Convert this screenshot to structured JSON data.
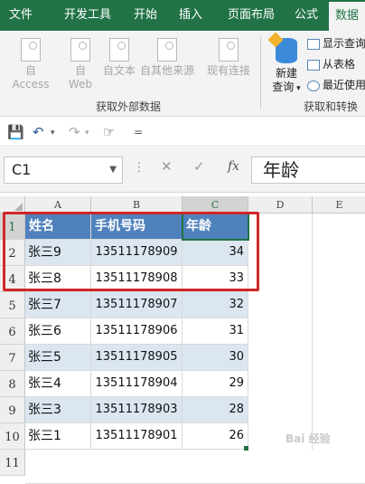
{
  "ribbon": {
    "tabs": [
      {
        "label": "文件",
        "active": false
      },
      {
        "label": "开发工具",
        "active": false
      },
      {
        "label": "开始",
        "active": false
      },
      {
        "label": "插入",
        "active": false
      },
      {
        "label": "页面布局",
        "active": false
      },
      {
        "label": "公式",
        "active": false
      },
      {
        "label": "数据",
        "active": true
      }
    ],
    "external_group": {
      "label": "获取外部数据",
      "buttons": [
        {
          "line1": "自 Access",
          "line2": "",
          "icon": "access-icon"
        },
        {
          "line1": "自",
          "line2": "Web",
          "icon": "web-icon"
        },
        {
          "line1": "自文本",
          "line2": "",
          "icon": "text-file-icon"
        },
        {
          "line1": "自其他来源",
          "line2": "",
          "icon": "other-sources-icon"
        },
        {
          "line1": "现有连接",
          "line2": "",
          "icon": "existing-connection-icon"
        }
      ]
    },
    "transform_group": {
      "label": "获取和转换",
      "new_query_line1": "新建",
      "new_query_line2": "查询",
      "small_commands": [
        "显示查询",
        "从表格",
        "最近使用"
      ]
    }
  },
  "qat": {
    "save": "💾",
    "undo": "↶",
    "redo": "↷",
    "touch": "☞",
    "more": "="
  },
  "formula_bar": {
    "name_box": "C1",
    "cancel": "✕",
    "enter": "✓",
    "fx": "fx",
    "content": "年龄"
  },
  "sheet": {
    "columns": [
      "A",
      "B",
      "C",
      "D",
      "E"
    ],
    "selected_column": "C",
    "rows": [
      "1",
      "2",
      "4",
      "5",
      "6",
      "7",
      "8",
      "9",
      "10",
      "11"
    ],
    "selected_row": "1",
    "header": [
      "姓名",
      "手机号码",
      "年龄"
    ],
    "data": [
      [
        "张三9",
        "13511178909",
        "34"
      ],
      [
        "张三8",
        "13511178908",
        "33"
      ],
      [
        "张三7",
        "13511178907",
        "32"
      ],
      [
        "张三6",
        "13511178906",
        "31"
      ],
      [
        "张三5",
        "13511178905",
        "30"
      ],
      [
        "张三4",
        "13511178904",
        "29"
      ],
      [
        "张三3",
        "13511178903",
        "28"
      ],
      [
        "张三1",
        "13511178901",
        "26"
      ]
    ]
  },
  "colors": {
    "ribbon_green": "#217346",
    "table_header": "#4f81bd",
    "table_band": "#dce6f1",
    "highlight_red": "#d0262a"
  }
}
